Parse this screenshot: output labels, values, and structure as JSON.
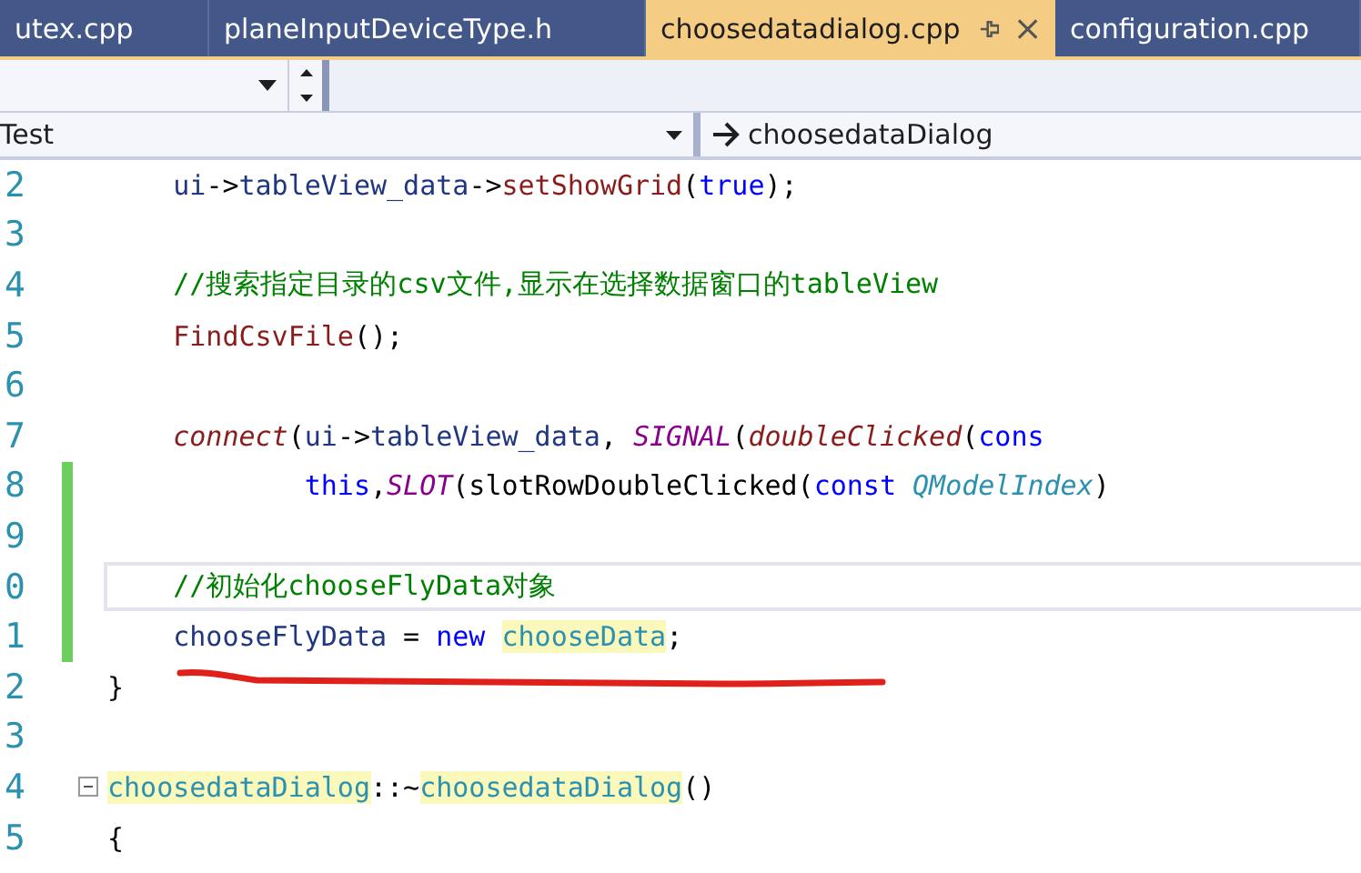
{
  "tabs": [
    {
      "label": "utex.cpp",
      "selected": false
    },
    {
      "label": "planeInputDeviceType.h",
      "selected": false
    },
    {
      "label": "choosedatadialog.cpp",
      "selected": true
    },
    {
      "label": "configuration.cpp",
      "selected": false
    }
  ],
  "navigation": {
    "scope": "Test",
    "member": "choosedataDialog"
  },
  "lines": [
    {
      "number": "2",
      "changed": false,
      "current": false,
      "foldable": false,
      "tokens": [
        {
          "text": "    ui",
          "kind": "variable"
        },
        {
          "text": "->",
          "kind": "plain"
        },
        {
          "text": "tableView_data",
          "kind": "variable"
        },
        {
          "text": "->",
          "kind": "plain"
        },
        {
          "text": "setShowGrid",
          "kind": "function"
        },
        {
          "text": "(",
          "kind": "plain"
        },
        {
          "text": "true",
          "kind": "keyword"
        },
        {
          "text": ");",
          "kind": "plain"
        }
      ]
    },
    {
      "number": "3",
      "changed": false,
      "current": false,
      "foldable": false
    },
    {
      "number": "4",
      "changed": false,
      "current": false,
      "foldable": false,
      "tokens": [
        {
          "text": "    //搜索指定目录的csv文件,显示在选择数据窗口的tableView",
          "kind": "comment"
        }
      ]
    },
    {
      "number": "5",
      "changed": false,
      "current": false,
      "foldable": false,
      "tokens": [
        {
          "text": "    FindCsvFile",
          "kind": "function"
        },
        {
          "text": "();",
          "kind": "plain"
        }
      ]
    },
    {
      "number": "6",
      "changed": false,
      "current": false,
      "foldable": false
    },
    {
      "number": "7",
      "changed": false,
      "current": false,
      "foldable": false,
      "tokens": [
        {
          "text": "    connect",
          "kind": "function-italic"
        },
        {
          "text": "(",
          "kind": "plain"
        },
        {
          "text": "ui",
          "kind": "variable"
        },
        {
          "text": "->",
          "kind": "plain"
        },
        {
          "text": "tableView_data",
          "kind": "variable"
        },
        {
          "text": ", ",
          "kind": "plain"
        },
        {
          "text": "SIGNAL",
          "kind": "macro"
        },
        {
          "text": "(",
          "kind": "plain"
        },
        {
          "text": "doubleClicked",
          "kind": "function-italic"
        },
        {
          "text": "(",
          "kind": "plain"
        },
        {
          "text": "cons",
          "kind": "keyword"
        }
      ]
    },
    {
      "number": "8",
      "changed": true,
      "current": false,
      "foldable": false,
      "tokens": [
        {
          "text": "            this",
          "kind": "keyword"
        },
        {
          "text": ",",
          "kind": "plain"
        },
        {
          "text": "SLOT",
          "kind": "macro"
        },
        {
          "text": "(slotRowDoubleClicked(",
          "kind": "plain"
        },
        {
          "text": "const ",
          "kind": "keyword"
        },
        {
          "text": "QModelIndex",
          "kind": "type"
        },
        {
          "text": ")",
          "kind": "plain"
        }
      ]
    },
    {
      "number": "9",
      "changed": true,
      "current": false,
      "foldable": false
    },
    {
      "number": "0",
      "changed": true,
      "current": true,
      "foldable": false,
      "tokens": [
        {
          "text": "    //初始化chooseFlyData对象",
          "kind": "comment"
        }
      ]
    },
    {
      "number": "1",
      "changed": true,
      "current": false,
      "foldable": false,
      "tokens": [
        {
          "text": "    chooseFlyData",
          "kind": "variable"
        },
        {
          "text": " = ",
          "kind": "plain"
        },
        {
          "text": "new ",
          "kind": "keyword"
        },
        {
          "text": "chooseData",
          "kind": "class",
          "highlighted": true
        },
        {
          "text": ";",
          "kind": "plain"
        }
      ]
    },
    {
      "number": "2",
      "changed": false,
      "current": false,
      "foldable": false,
      "tokens": [
        {
          "text": "}",
          "kind": "plain"
        }
      ]
    },
    {
      "number": "3",
      "changed": false,
      "current": false,
      "foldable": false
    },
    {
      "number": "4",
      "changed": false,
      "current": false,
      "foldable": true,
      "tokens": [
        {
          "text": "choosedataDialog",
          "kind": "class",
          "highlighted": true
        },
        {
          "text": "::~",
          "kind": "plain"
        },
        {
          "text": "choosedataDialog",
          "kind": "class",
          "highlighted": true
        },
        {
          "text": "()",
          "kind": "plain"
        }
      ]
    },
    {
      "number": "5",
      "changed": false,
      "current": false,
      "foldable": false,
      "tokens": [
        {
          "text": "{",
          "kind": "plain"
        }
      ]
    }
  ]
}
